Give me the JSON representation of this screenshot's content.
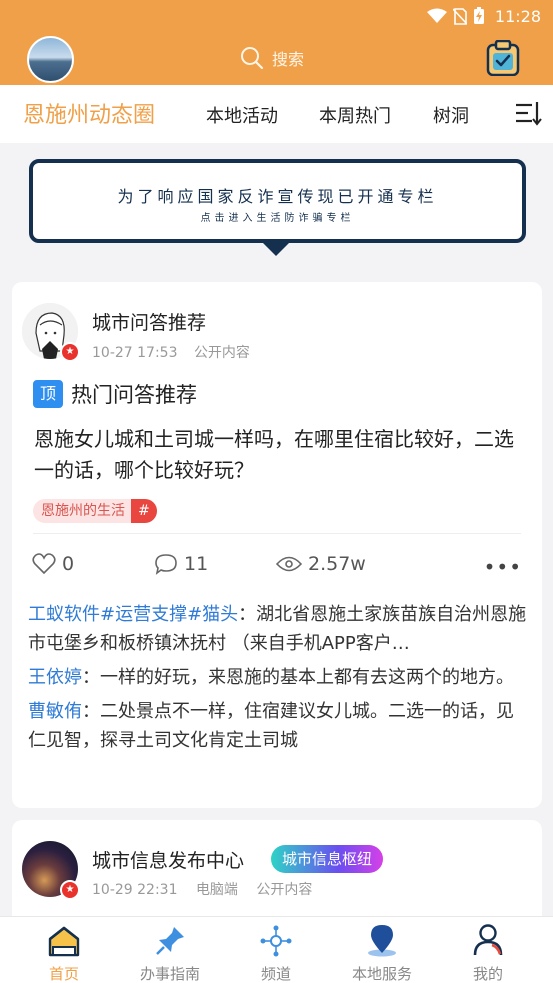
{
  "status_bar": {
    "time": "11:28"
  },
  "header": {
    "search_placeholder": "搜索",
    "icons": [
      "avatar",
      "search-icon",
      "clipboard-check-icon"
    ]
  },
  "tabs": {
    "main": "恩施州动态圈",
    "items": [
      "本地活动",
      "本周热门",
      "树洞"
    ]
  },
  "banner": {
    "title": "为了响应国家反诈宣传现已开通专栏",
    "subtitle": "点击进入生活防诈骗专栏"
  },
  "posts": [
    {
      "author": "城市问答推荐",
      "time": "10-27 17:53",
      "visibility": "公开内容",
      "pin_label": "顶",
      "pin_title": "热门问答推荐",
      "body": "恩施女儿城和土司城一样吗，在哪里住宿比较好，二选一的话，哪个比较好玩？",
      "topic_tag": "恩施州的生活",
      "topic_hash": "#",
      "likes": "0",
      "comments_count": "11",
      "views": "2.57w",
      "more": "•••",
      "comments": [
        {
          "user": "工蚁软件#运营支撑#猫头",
          "sep": "：",
          "text": "湖北省恩施土家族苗族自治州恩施市屯堡乡和板桥镇沐抚村 （来自手机APP客户…"
        },
        {
          "user": "王依婷",
          "sep": "：",
          "text": "一样的好玩，来恩施的基本上都有去这两个的地方。"
        },
        {
          "user": "曹敏侑",
          "sep": "：",
          "text": "二处景点不一样，住宿建议女儿城。二选一的话，见仁见智，探寻土司文化肯定土司城"
        }
      ]
    },
    {
      "author": "城市信息发布中心",
      "badge": "城市信息枢纽",
      "time": "10-29 22:31",
      "source": "电脑端",
      "visibility": "公开内容"
    }
  ],
  "bottom_nav": {
    "items": [
      "首页",
      "办事指南",
      "频道",
      "本地服务",
      "我的"
    ],
    "active": "首页",
    "accent": "#f0a048"
  },
  "colors": {
    "header": "#f0a048",
    "link": "#2f7bd6",
    "banner_border": "#15304f"
  }
}
